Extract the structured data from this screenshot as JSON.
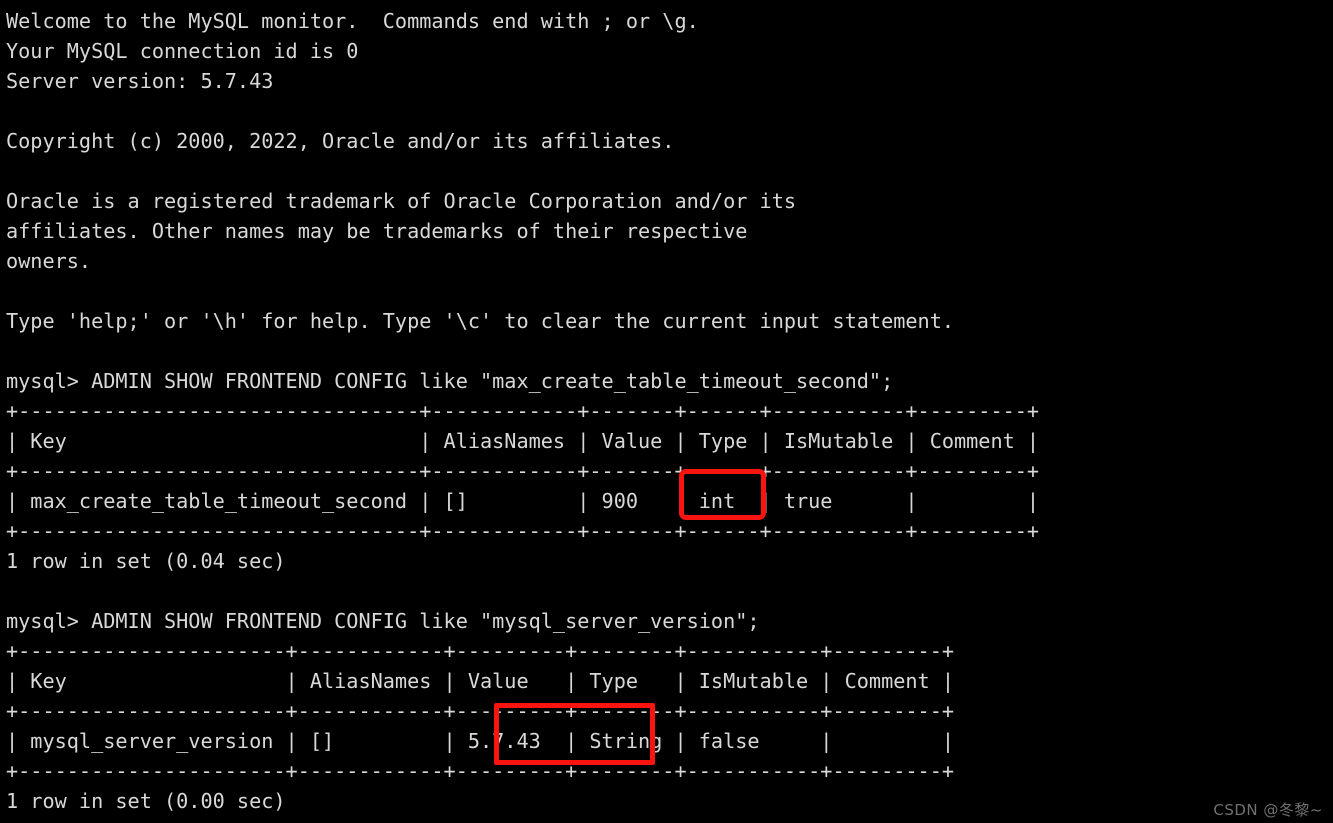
{
  "terminal": {
    "background_color": "#000000",
    "text_color": "#d8d8d8",
    "highlight_color": "#fa1410",
    "content": "Welcome to the MySQL monitor.  Commands end with ; or \\g.\nYour MySQL connection id is 0\nServer version: 5.7.43\n\nCopyright (c) 2000, 2022, Oracle and/or its affiliates.\n\nOracle is a registered trademark of Oracle Corporation and/or its\naffiliates. Other names may be trademarks of their respective\nowners.\n\nType 'help;' or '\\h' for help. Type '\\c' to clear the current input statement.\n\nmysql> ADMIN SHOW FRONTEND CONFIG like \"max_create_table_timeout_second\";\n+---------------------------------+------------+-------+------+-----------+---------+\n| Key                             | AliasNames | Value | Type | IsMutable | Comment |\n+---------------------------------+------------+-------+------+-----------+---------+\n| max_create_table_timeout_second | []         | 900   | int  | true      |         |\n+---------------------------------+------------+-------+------+-----------+---------+\n1 row in set (0.04 sec)\n\nmysql> ADMIN SHOW FRONTEND CONFIG like \"mysql_server_version\";\n+----------------------+------------+---------+--------+-----------+---------+\n| Key                  | AliasNames | Value   | Type   | IsMutable | Comment |\n+----------------------+------------+---------+--------+-----------+---------+\n| mysql_server_version | []         | 5.7.43  | String | false     |         |\n+----------------------+------------+---------+--------+-----------+---------+\n1 row in set (0.00 sec)"
  },
  "banner": {
    "line_welcome": "Welcome to the MySQL monitor.  Commands end with ; or \\g.",
    "line_connection_id": "Your MySQL connection id is 0",
    "line_server_version": "Server version: 5.7.43",
    "line_copyright": "Copyright (c) 2000, 2022, Oracle and/or its affiliates.",
    "line_trademark_1": "Oracle is a registered trademark of Oracle Corporation and/or its",
    "line_trademark_2": "affiliates. Other names may be trademarks of their respective",
    "line_trademark_3": "owners.",
    "line_help": "Type 'help;' or '\\h' for help. Type '\\c' to clear the current input statement."
  },
  "prompt": {
    "symbol": "mysql>"
  },
  "commands": [
    {
      "prompt": "mysql>",
      "text": "ADMIN SHOW FRONTEND CONFIG like \"max_create_table_timeout_second\";",
      "result_status": "1 row in set (0.04 sec)"
    },
    {
      "prompt": "mysql>",
      "text": "ADMIN SHOW FRONTEND CONFIG like \"mysql_server_version\";",
      "result_status": "1 row in set (0.00 sec)"
    }
  ],
  "tables": [
    {
      "columns": [
        "Key",
        "AliasNames",
        "Value",
        "Type",
        "IsMutable",
        "Comment"
      ],
      "widths": [
        31,
        10,
        5,
        4,
        9,
        7
      ],
      "rows": [
        [
          "max_create_table_timeout_second",
          "[]",
          "900",
          "int",
          "true",
          ""
        ]
      ],
      "highlighted_cell": {
        "row": 0,
        "column": "Value",
        "value": "900"
      }
    },
    {
      "columns": [
        "Key",
        "AliasNames",
        "Value",
        "Type",
        "IsMutable",
        "Comment"
      ],
      "widths": [
        20,
        10,
        7,
        6,
        9,
        7
      ],
      "rows": [
        [
          "mysql_server_version",
          "[]",
          "5.7.43",
          "String",
          "false",
          ""
        ]
      ],
      "highlighted_cell": {
        "row": 0,
        "column": "Value",
        "value": "5.7.43"
      }
    }
  ],
  "watermark": {
    "text": "CSDN @冬黎~"
  }
}
